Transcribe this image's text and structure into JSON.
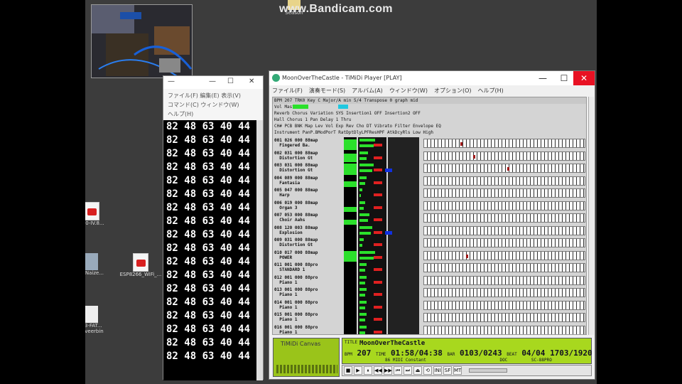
{
  "watermark": "www.Bandicam.com",
  "desktop": {
    "top_icon_label": "Season",
    "left_icon_label": "-123",
    "pdf1_label": "000-IV.8...",
    "icon2_label": "u_Naize...",
    "pdf2_label": "ESP8266_WiFi_...",
    "file_label": "13-FAT...\nreveerbin"
  },
  "console": {
    "title": "—",
    "menu1": "ファイル(F)  編集(E)  表示(V)",
    "menu2": "コマンド(C)  ウィンドウ(W)",
    "menu3": "ヘルプ(H)",
    "line": "82 48 63 40 44",
    "line_count": 18
  },
  "timidity": {
    "title": "MoonOverTheCastle - TiMiDi Player [PLAY]",
    "menu": [
      "ファイル(F)",
      "演奏モード(S)",
      "アルバム(A)",
      "ウィンドウ(W)",
      "オプション(O)",
      "ヘルプ(H)"
    ],
    "header_line1": "BPM 207 TRK0 Key  C Major/A min   5/4 Transpose  0  graph mid",
    "header_line2": "Vol                        Master",
    "header_line3": "Reverb            Chorus         Variation   SYS  Insertion1  OFF  Insertion2  OFF",
    "header_line4": "Hall              Chorus 1       Pan Delay 1      Thru",
    "header_line5": "CH# PCB BNK Map   Lev Vol Exp Rev Cho DT  Vibrato    Filter    Envelope  EQ",
    "header_line6": "    Instrument    PanP.BModPorT  RatDptDlyLPFResHPF AtkDcyRls Low High",
    "channels": [
      {
        "num": "001 026 000 88map",
        "inst": "Fingered Ba.",
        "level": 0.85
      },
      {
        "num": "002 031 000 88map",
        "inst": "Distortion Gt",
        "level": 0.7
      },
      {
        "num": "003 031 000 88map",
        "inst": "Distortion Gt",
        "level": 0.9
      },
      {
        "num": "004 089 000 88map",
        "inst": "Fantasia",
        "level": 0.5
      },
      {
        "num": "005 047 000 88map",
        "inst": "Harp",
        "level": 0.0
      },
      {
        "num": "006 019 000 88map",
        "inst": "Organ 3",
        "level": 0.45
      },
      {
        "num": "007 053 000 88map",
        "inst": "Choir Aahs",
        "level": 0.4
      },
      {
        "num": "008 120 003 88map",
        "inst": "Explosion",
        "level": 0.0
      },
      {
        "num": "009 031 000 88map",
        "inst": "Distortion Gt",
        "level": 0.0
      },
      {
        "num": "010 017 000 88map",
        "inst": "POWER",
        "level": 0.9
      },
      {
        "num": "011 001 000 88pro",
        "inst": "STANDARD 1",
        "level": 0.0
      },
      {
        "num": "012 001 000 88pro",
        "inst": "Piano 1",
        "level": 0.0
      },
      {
        "num": "013 001 000 88pro",
        "inst": "Piano 1",
        "level": 0.0
      },
      {
        "num": "014 001 000 88pro",
        "inst": "Piano 1",
        "level": 0.0
      },
      {
        "num": "015 001 000 88pro",
        "inst": "Piano 1",
        "level": 0.0
      },
      {
        "num": "016 001 000 88pro",
        "inst": "Piano 1",
        "level": 0.0
      }
    ],
    "canvas_label": "TiMiDi Canvas",
    "info": {
      "title_label": "TITLE",
      "title": "MoonOverTheCastle",
      "bpm_label": "BPM",
      "bpm": "207",
      "time_label": "TIME",
      "time": "01:58/04:38",
      "bar_label": "BAR",
      "bar": "0103/0243",
      "beat_label": "BEAT",
      "beat": "04/04",
      "ticks": "1703/1920",
      "voices": "86",
      "mode": "MIDI Constant",
      "ctrl": "DOC",
      "device": "SC-88PRO"
    },
    "controls": [
      "■",
      "▶",
      "⏸",
      "◀◀",
      "▶▶",
      "⏮",
      "⏭",
      "⏏",
      "⟲",
      "INI",
      "SF",
      "MT"
    ]
  }
}
